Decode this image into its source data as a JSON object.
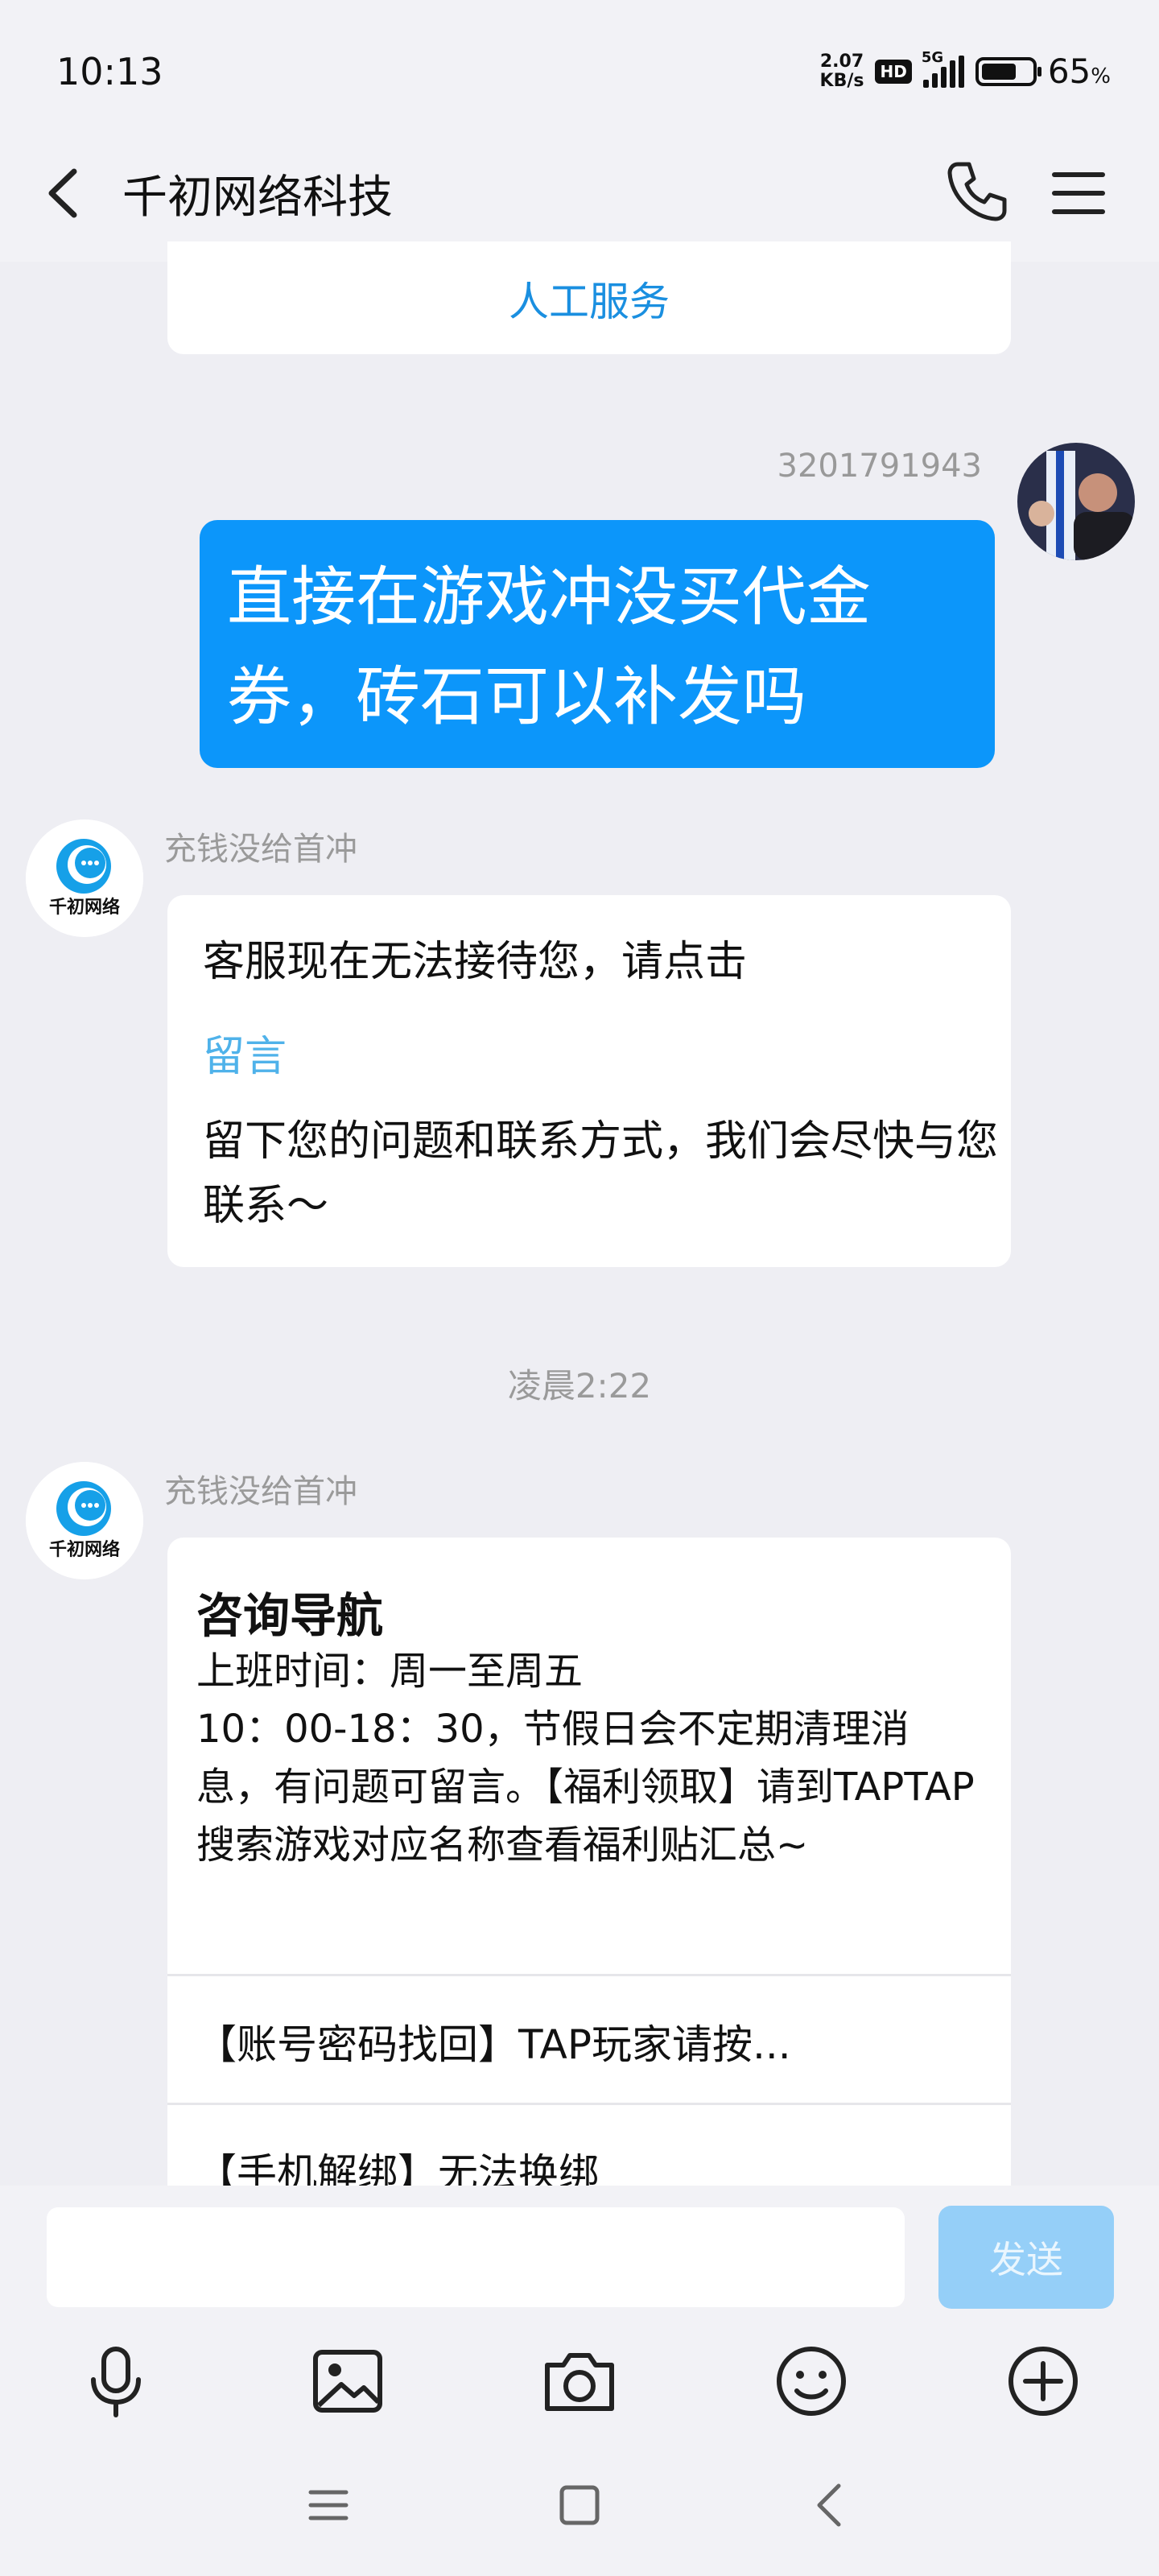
{
  "status_bar": {
    "time": "10:13",
    "net_speed_value": "2.07",
    "net_speed_unit": "KB/s",
    "hd_badge": "HD",
    "network_type": "5G",
    "battery_percent": "65",
    "battery_unit": "%"
  },
  "header": {
    "title": "千初网络科技"
  },
  "messages": {
    "top_card_action": "人工服务",
    "my_id": "3201791943",
    "my_text": "直接在游戏冲没买代金券，砖石可以补发吗",
    "bot_name_1": "充钱没给首冲",
    "card2_line1": "客服现在无法接待您，请点击",
    "card2_link": "留言",
    "card2_line2": "留下您的问题和联系方式，我们会尽快与您联系～",
    "time_separator": "凌晨2:22",
    "bot_name_2": "充钱没给首冲",
    "nav_title": "咨询导航",
    "nav_body_line1": "上班时间：周一至周五",
    "nav_body_line2": "10：00-18：30，节假日会不定期清理消息，有问题可留言。【福利领取】请到TAPTAP搜索游戏对应名称查看福利贴汇总~",
    "faq_1": "【账号密码找回】TAP玩家请按...",
    "faq_2": "【手机解绑】无法换绑"
  },
  "bot_logo_text": "千初网络",
  "input_bar": {
    "placeholder": "",
    "send_label": "发送"
  },
  "icons": {
    "toolbar": [
      "microphone-icon",
      "image-icon",
      "camera-icon",
      "emoji-icon",
      "plus-circle-icon"
    ],
    "system_nav": [
      "recent-apps-icon",
      "home-icon",
      "back-nav-icon"
    ]
  },
  "colors": {
    "my_bubble": "#0c96fa",
    "link": "#4fb2ea",
    "send_button": "#95cff8",
    "service_text": "#1a8fe0"
  }
}
